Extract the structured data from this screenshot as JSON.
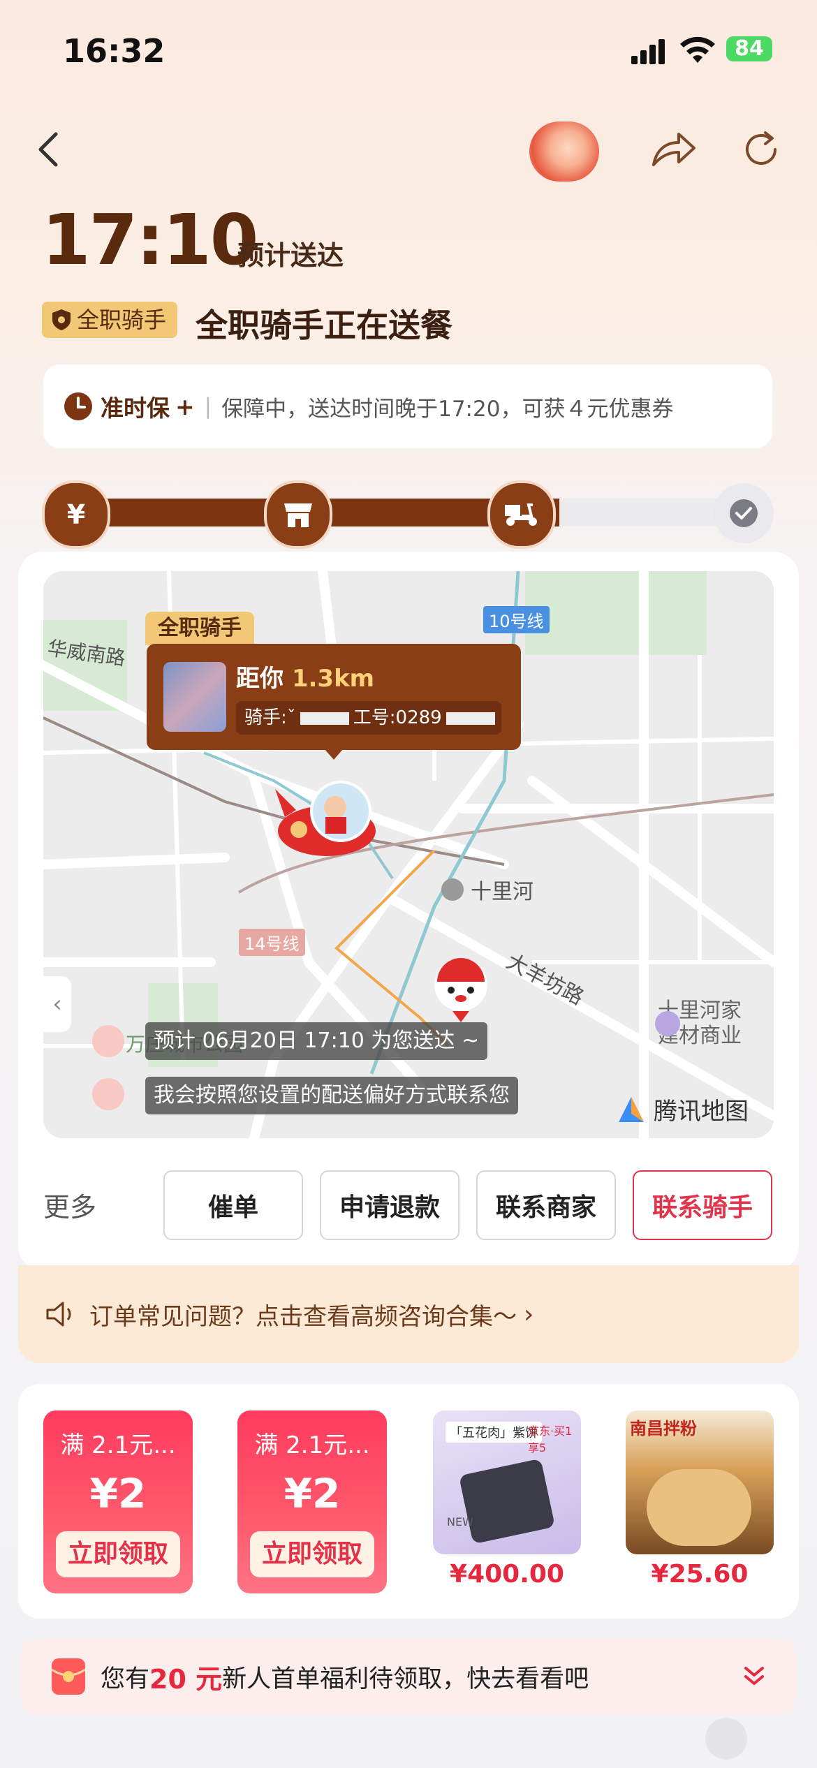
{
  "status_bar": {
    "time": "16:32",
    "battery": "84"
  },
  "header": {
    "eta_time": "17:10",
    "eta_label": "预计送达",
    "rider_tag": "全职骑手",
    "status_text": "全职骑手正在送餐"
  },
  "guarantee": {
    "title": "准时保",
    "plus": "+",
    "text": "保障中，送达时间晚于17:20，可获４元优惠券"
  },
  "progress": {
    "completed_fraction": 0.73,
    "steps": [
      "pay-icon",
      "store-icon",
      "scooter-icon",
      "check-icon"
    ]
  },
  "map": {
    "rider_tag": "全职骑手",
    "distance_prefix": "距你",
    "distance_value": "1.3km",
    "rider_info_prefix": "骑手:",
    "rider_masked": "ˇ",
    "employee_prefix": "工号:0289",
    "labels": {
      "road_huawei": "华威南路",
      "line10": "10号线",
      "line14": "14号线",
      "shilihe": "十里河",
      "dayangfang": "大羊坊路",
      "park": "万庄城市公园",
      "mall1": "十里河家",
      "mall2": "建材商业"
    },
    "msg1": "预计 06月20日 17:10 为您送达 ~",
    "msg2": "我会按照您设置的配送偏好方式联系您",
    "map_logo": "腾讯地图"
  },
  "actions": {
    "more": "更多",
    "urge": "催单",
    "refund": "申请退款",
    "contact_merchant": "联系商家",
    "contact_rider": "联系骑手"
  },
  "faq": {
    "text": "订单常见问题？点击查看高频咨询合集～"
  },
  "promos": {
    "coupons": [
      {
        "title": "满 2.1元...",
        "amount": "¥2",
        "cta": "立即领取"
      },
      {
        "title": "满 2.1元...",
        "amount": "¥2",
        "cta": "立即领取"
      }
    ],
    "products": [
      {
        "price": "¥400.00",
        "img_text1": "「五花肉」紫饼",
        "img_text2": "京东·买1享5",
        "img_text3": "NEW"
      },
      {
        "price": "¥25.60",
        "img_text1": "南昌拌粉"
      }
    ]
  },
  "newbie": {
    "prefix": "您有",
    "amount": "20 元",
    "suffix": "新人首单福利待领取，快去看看吧"
  },
  "colors": {
    "brand_brown": "#7c3510",
    "accent_red": "#e6283e",
    "tag_gold": "#f2c877"
  }
}
